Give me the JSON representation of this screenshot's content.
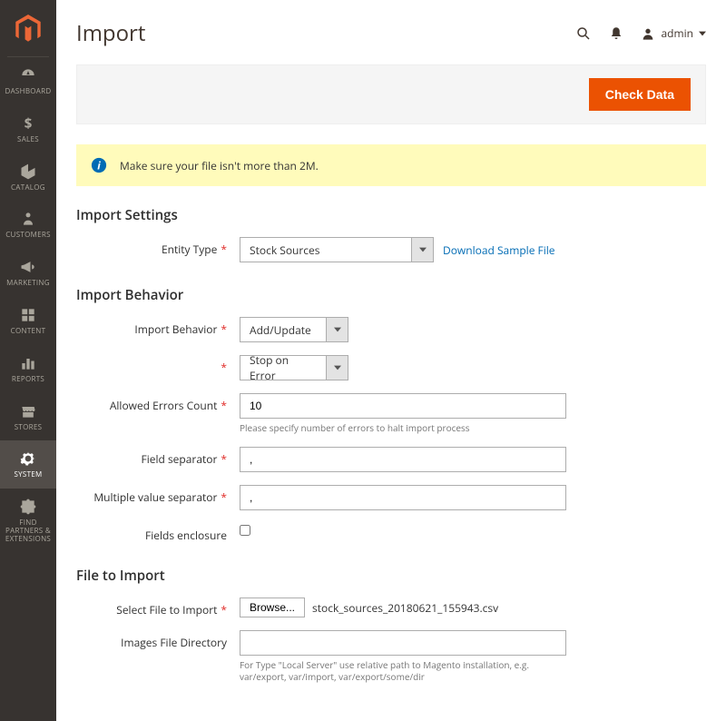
{
  "sidebar": {
    "items": [
      {
        "label": "DASHBOARD",
        "icon": "dashboard"
      },
      {
        "label": "SALES",
        "icon": "dollar"
      },
      {
        "label": "CATALOG",
        "icon": "box"
      },
      {
        "label": "CUSTOMERS",
        "icon": "person"
      },
      {
        "label": "MARKETING",
        "icon": "megaphone"
      },
      {
        "label": "CONTENT",
        "icon": "blocks"
      },
      {
        "label": "REPORTS",
        "icon": "bars"
      },
      {
        "label": "STORES",
        "icon": "storefront"
      },
      {
        "label": "SYSTEM",
        "icon": "gear"
      },
      {
        "label": "FIND PARTNERS & EXTENSIONS",
        "icon": "puzzle"
      }
    ]
  },
  "header": {
    "title": "Import",
    "user": "admin"
  },
  "action_bar": {
    "check_data": "Check Data"
  },
  "notice": {
    "message": "Make sure your file isn't more than 2M."
  },
  "sections": {
    "import_settings": {
      "title": "Import Settings",
      "entity_type": {
        "label": "Entity Type",
        "value": "Stock Sources"
      },
      "download_link": "Download Sample File"
    },
    "import_behavior": {
      "title": "Import Behavior",
      "behavior": {
        "label": "Import Behavior",
        "value": "Add/Update"
      },
      "error_strategy": {
        "value": "Stop on Error"
      },
      "allowed_errors": {
        "label": "Allowed Errors Count",
        "value": "10",
        "hint": "Please specify number of errors to halt import process"
      },
      "field_separator": {
        "label": "Field separator",
        "value": ","
      },
      "multi_separator": {
        "label": "Multiple value separator",
        "value": ","
      },
      "fields_enclosure": {
        "label": "Fields enclosure"
      }
    },
    "file_to_import": {
      "title": "File to Import",
      "select_file": {
        "label": "Select File to Import",
        "browse": "Browse...",
        "filename": "stock_sources_20180621_155943.csv"
      },
      "images_dir": {
        "label": "Images File Directory",
        "value": "",
        "hint": "For Type \"Local Server\" use relative path to Magento installation, e.g. var/export, var/import, var/export/some/dir"
      }
    }
  }
}
